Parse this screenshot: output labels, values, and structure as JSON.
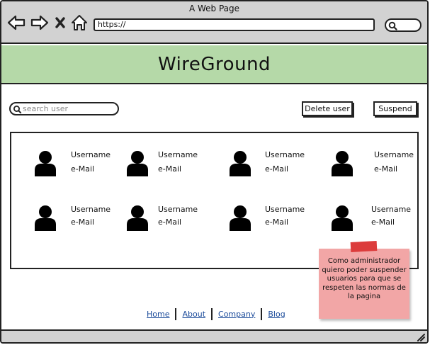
{
  "window": {
    "title": "A Web Page",
    "url": "https://"
  },
  "header": {
    "title": "WireGround"
  },
  "toolbar": {
    "search_placeholder": "search user",
    "delete_label": "Delete user",
    "suspend_label": "Suspend"
  },
  "users": [
    {
      "username": "Username",
      "email": "e-Mail"
    },
    {
      "username": "Username",
      "email": "e-Mail"
    },
    {
      "username": "Username",
      "email": "e-Mail"
    },
    {
      "username": "Username",
      "email": "e-Mail"
    },
    {
      "username": "Username",
      "email": "e-Mail"
    },
    {
      "username": "Username",
      "email": "e-Mail"
    },
    {
      "username": "Username",
      "email": "e-Mail"
    },
    {
      "username": "Username",
      "email": "e-Mail"
    }
  ],
  "sticky_note": {
    "text": "Como administrador quiero poder suspender usuarios para que se respeten las normas de la pagina"
  },
  "footer": {
    "links": [
      "Home",
      "About",
      "Company",
      "Blog"
    ]
  },
  "colors": {
    "header_bg": "#b5d9a8",
    "chrome_bg": "#d2d2d2",
    "sticky_bg": "#f2a6a6",
    "tape": "#dc3c3c",
    "link": "#1a4a9a"
  }
}
